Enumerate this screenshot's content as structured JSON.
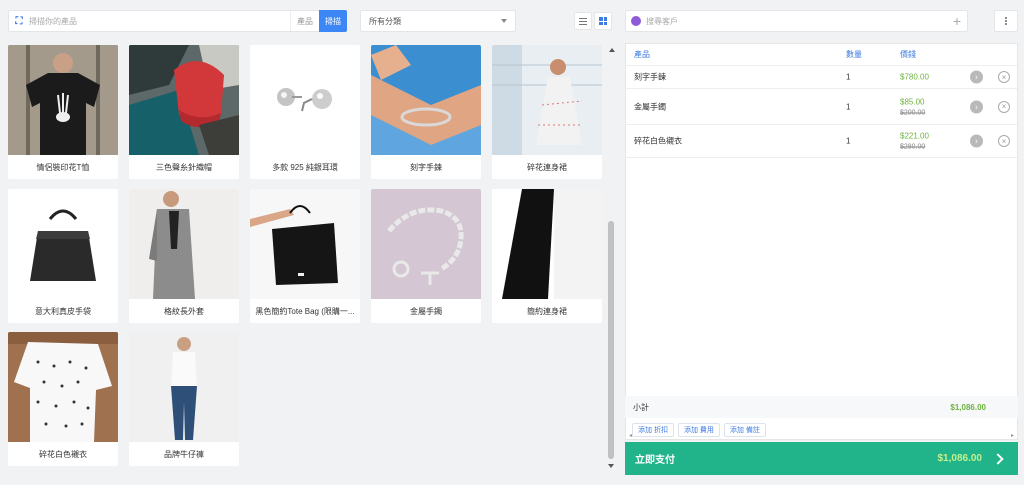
{
  "search": {
    "placeholder": "掃描你的產品",
    "type_label": "產品",
    "scan_label": "掃描"
  },
  "category": {
    "selected": "所有分類"
  },
  "customer": {
    "placeholder": "搜尋客戶"
  },
  "products": [
    {
      "name": "情侶裝印花T恤"
    },
    {
      "name": "三色聲糸針織帽"
    },
    {
      "name": "多款 925 純銀耳環"
    },
    {
      "name": "刻字手鍊"
    },
    {
      "name": "碎花連身裙"
    },
    {
      "name": "意大利真皮手袋"
    },
    {
      "name": "格紋長外套"
    },
    {
      "name": "黑色簡約Tote Bag (限購一..."
    },
    {
      "name": "金屬手鐲"
    },
    {
      "name": "簡約連身裙"
    },
    {
      "name": "碎花白色襯衣"
    },
    {
      "name": "品牌牛仔褲"
    }
  ],
  "cart": {
    "headers": {
      "product": "產品",
      "qty": "數量",
      "price": "價錢"
    },
    "items": [
      {
        "name": "刻字手鍊",
        "qty": "1",
        "price": "$780.00",
        "old_price": ""
      },
      {
        "name": "金屬手鐲",
        "qty": "1",
        "price": "$85.00",
        "old_price": "$200.00"
      },
      {
        "name": "碎花白色襯衣",
        "qty": "1",
        "price": "$221.00",
        "old_price": "$280.00"
      }
    ]
  },
  "summary": {
    "subtotal_label": "小計",
    "subtotal": "$1,086.00"
  },
  "actions": {
    "discount": "添加 折扣",
    "fee": "添加 費用",
    "note": "添加 備註"
  },
  "pay": {
    "label": "立即支付",
    "amount": "$1,086.00"
  },
  "colors": {
    "accent": "#3d7be0",
    "pay": "#21b38a",
    "price": "#6db33f"
  }
}
